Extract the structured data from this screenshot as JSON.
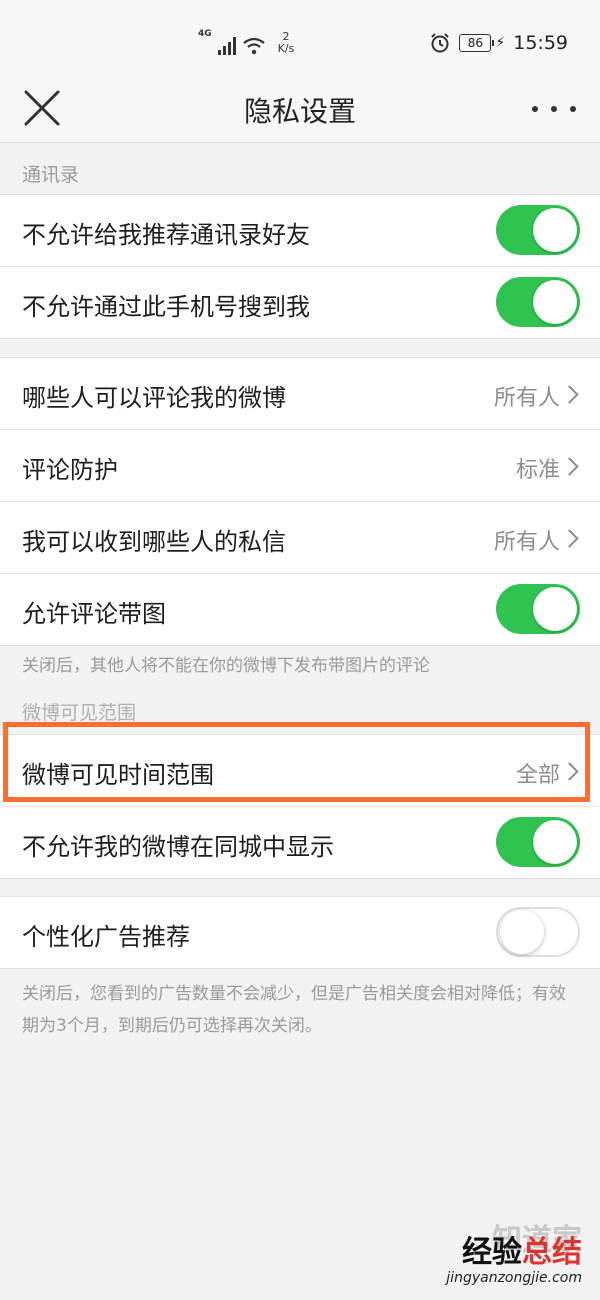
{
  "status_bar": {
    "network": "4G",
    "speed_value": "2",
    "speed_unit": "K/s",
    "battery": "86",
    "time": "15:59",
    "icons": [
      "signal-icon",
      "wifi-icon",
      "alarm-icon",
      "battery-icon",
      "charging-icon"
    ]
  },
  "nav": {
    "title": "隐私设置",
    "left_icon": "close-icon",
    "right_icon": "more-icon"
  },
  "sections": {
    "contacts_label": "通讯录",
    "contacts": [
      {
        "label": "不允许给我推荐通讯录好友",
        "toggle": true
      },
      {
        "label": "不允许通过此手机号搜到我",
        "toggle": true
      }
    ],
    "interaction": [
      {
        "label": "哪些人可以评论我的微博",
        "value": "所有人"
      },
      {
        "label": "评论防护",
        "value": "标准"
      },
      {
        "label": "我可以收到哪些人的私信",
        "value": "所有人"
      },
      {
        "label": "允许评论带图",
        "toggle": true
      }
    ],
    "interaction_hint": "关闭后，其他人将不能在你的微博下发布带图片的评论",
    "visibility_label": "微博可见范围",
    "visibility": [
      {
        "label": "微博可见时间范围",
        "value": "全部"
      },
      {
        "label": "不允许我的微博在同城中显示",
        "toggle": true
      }
    ],
    "ads": [
      {
        "label": "个性化广告推荐",
        "toggle": false
      }
    ],
    "ads_hint": "关闭后，您看到的广告数量不会减少，但是广告相关度会相对降低；有效期为3个月，到期后仍可选择再次关闭。"
  },
  "watermark": {
    "top_light": "知道家",
    "top_brand": "经验",
    "top_brand_red": "总结",
    "url": "jingyanzongjie.com"
  },
  "colors": {
    "toggle_on": "#2fc44f",
    "highlight_border": "#ff6d33",
    "background": "#f2f2f2"
  }
}
